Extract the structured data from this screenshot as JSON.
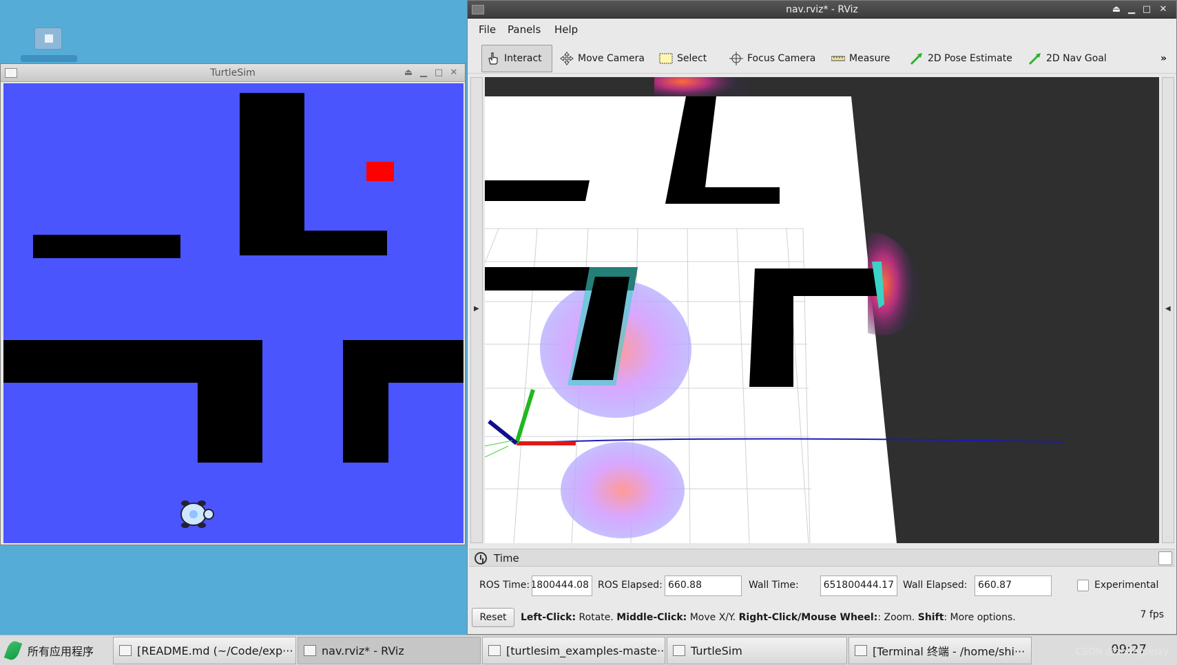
{
  "desktop": {
    "icon_name": "home-folder-icon"
  },
  "turtlesim": {
    "title": "TurtleSim",
    "background": "#4a55fd",
    "obstacle_color": "#000000",
    "goal_color": "#ff0000"
  },
  "rviz": {
    "title": "nav.rviz* - RViz",
    "menu": {
      "file": "File",
      "panels": "Panels",
      "help": "Help"
    },
    "tools": {
      "interact": "Interact",
      "move_camera": "Move Camera",
      "select": "Select",
      "focus_camera": "Focus Camera",
      "measure": "Measure",
      "pose_estimate": "2D Pose Estimate",
      "nav_goal": "2D Nav Goal",
      "more": "»"
    },
    "time_panel": {
      "title": "Time",
      "ros_time_label": "ROS Time:",
      "ros_time_value": "1800444.08",
      "ros_elapsed_label": "ROS Elapsed:",
      "ros_elapsed_value": "660.88",
      "wall_time_label": "Wall Time:",
      "wall_time_value": "651800444.17",
      "wall_elapsed_label": "Wall Elapsed:",
      "wall_elapsed_value": "660.87",
      "experimental_label": "Experimental"
    },
    "help": {
      "reset_label": "Reset",
      "left_click": "Left-Click:",
      "left_click_desc": " Rotate. ",
      "middle_click": "Middle-Click:",
      "middle_click_desc": " Move X/Y. ",
      "right_click": "Right-Click/Mouse Wheel:",
      "right_click_desc": ": Zoom. ",
      "shift": "Shift",
      "shift_desc": ": More options.",
      "fps": "7 fps"
    }
  },
  "taskbar": {
    "start_label": "所有应用程序",
    "tasks": [
      "[README.md (~/Code/exp···",
      "nav.rviz* - RViz",
      "[turtlesim_examples-maste···",
      "TurtleSim",
      "[Terminal 终端 - /home/shi···"
    ],
    "clock": "09:27",
    "watermark": "CSDN @zhangrelay"
  }
}
